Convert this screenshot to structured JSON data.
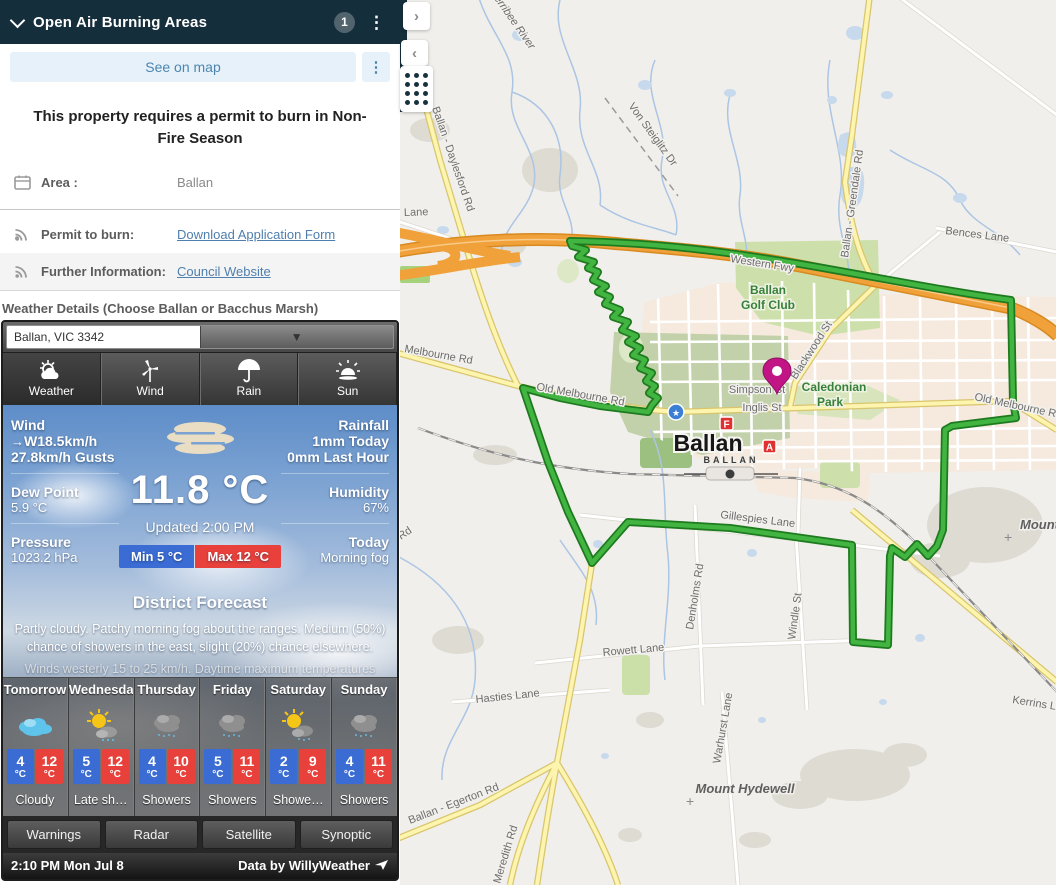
{
  "panel": {
    "header": {
      "title": "Open Air Burning Areas",
      "badge": "1",
      "menu_icon": "kebab",
      "collapse_icon": "chevron-down"
    },
    "see_on_map_label": "See on map",
    "notice": "This property requires a permit to burn in Non-Fire Season",
    "fields": {
      "area_label": "Area :",
      "area_value": "Ballan",
      "permit_label": "Permit to burn:",
      "permit_link": "Download Application Form",
      "info_label": "Further Information:",
      "info_link": "Council Website"
    },
    "weather_heading": "Weather Details (Choose Ballan or Bacchus Marsh)"
  },
  "weather": {
    "location": "Ballan, VIC 3342",
    "tabs": {
      "t0": "Weather",
      "t1": "Wind",
      "t2": "Rain",
      "t3": "Sun"
    },
    "current": {
      "wind_label": "Wind",
      "wind_arrow": "→",
      "wind_speed": "W18.5km/h",
      "wind_gusts": "27.8km/h Gusts",
      "dew_label": "Dew Point",
      "dew_value": "5.9 °C",
      "pressure_label": "Pressure",
      "pressure_value": "1023.2 hPa",
      "temp": "11.8 °C",
      "updated": "Updated 2:00 PM",
      "min": "Min 5 °C",
      "max": "Max 12 °C",
      "rain_label": "Rainfall",
      "rain_today": "1mm Today",
      "rain_hour": "0mm Last Hour",
      "humidity_label": "Humidity",
      "humidity_value": "67%",
      "today_label": "Today",
      "today_value": "Morning fog"
    },
    "district": {
      "title": "District Forecast",
      "text": "Partly cloudy. Patchy morning fog about the ranges. Medium (50%) chance of showers in the east, slight (20%) chance elsewhere.",
      "winds_line": "Winds westerly 15 to 25 km/h. Daytime maximum temperatures"
    },
    "deg": "°C",
    "forecast": [
      {
        "day": "Tomorrow",
        "min": "4",
        "max": "12",
        "cond": "Cloudy",
        "icon": "clouds"
      },
      {
        "day": "Wednesday",
        "min": "5",
        "max": "12",
        "cond": "Late sh…",
        "icon": "sun-cloud"
      },
      {
        "day": "Thursday",
        "min": "4",
        "max": "10",
        "cond": "Showers",
        "icon": "showers"
      },
      {
        "day": "Friday",
        "min": "5",
        "max": "11",
        "cond": "Showers",
        "icon": "showers"
      },
      {
        "day": "Saturday",
        "min": "2",
        "max": "9",
        "cond": "Showe…",
        "icon": "sun-showers"
      },
      {
        "day": "Sunday",
        "min": "4",
        "max": "11",
        "cond": "Showers",
        "icon": "showers"
      }
    ],
    "bottom_tabs": {
      "b0": "Warnings",
      "b1": "Radar",
      "b2": "Satellite",
      "b3": "Synoptic"
    },
    "status_time": "2:10 PM Mon Jul 8",
    "credit": "Data by WillyWeather"
  },
  "map": {
    "labels": {
      "river": "Werribee River",
      "von_steiglitz": "Von Steiglitz Dr",
      "daylesford": "Ballan - Daylesford Rd",
      "lane": "Lane",
      "western_fwy": "Western Fwy",
      "greendale": "Ballan - Greendale Rd",
      "bences": "Bences Lane",
      "golf_line1": "Ballan",
      "golf_line2": "Golf Club",
      "blackwood": "Blackwood St",
      "caledonian_line1": "Caledonian",
      "caledonian_line2": "Park",
      "simpson": "Simpson St",
      "inglis": "Inglis St",
      "town": "Ballan",
      "station": "BALLAN",
      "old_melbourne_w": "Old Melbourne Rd",
      "melbourne": "Melbourne Rd",
      "old_melbourne_e": "Old Melbourne Rd",
      "gillespies": "Gillespies Lane",
      "denholms": "Denholms Rd",
      "windle": "Windle St",
      "rowett": "Rowett Lane",
      "hasties": "Hasties Lane",
      "kerrins": "Kerrins Lane",
      "warhurst": "Warhurst Lane",
      "egerton": "Ballan - Egerton Rd",
      "meredith": "Meredith Rd",
      "mount_hydewell": "Mount Hydewell",
      "mount_east": "Mount",
      "rd_partial": "Rd",
      "plus": "+"
    },
    "markers": {
      "fuel": "F",
      "attraction": "A",
      "star": "★"
    }
  },
  "colors": {
    "header_bg": "#152e3c",
    "link": "#4f7fae",
    "boundary_green": "#3cb03f",
    "freeway_orange": "#f0a13a",
    "pin_magenta": "#c21585",
    "min_blue": "#3a6cd4",
    "max_red": "#e8403a"
  }
}
